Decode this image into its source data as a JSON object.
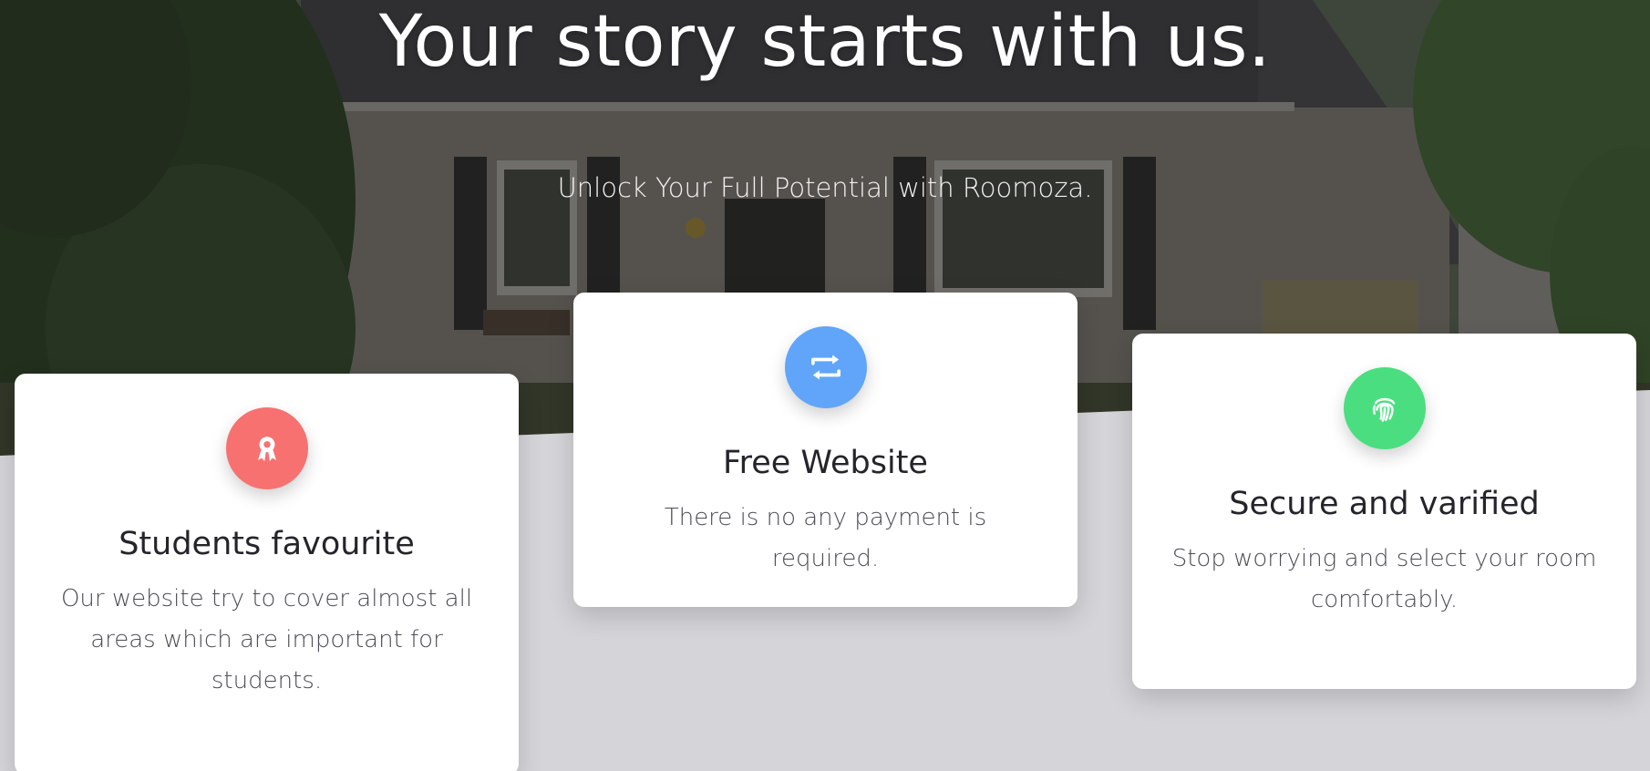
{
  "hero": {
    "title": "Your story starts with us.",
    "subtitle": "Unlock Your Full Potential with Roomoza."
  },
  "features": [
    {
      "icon": "award-ribbon-icon",
      "color": "#f87171",
      "title": "Students favourite",
      "text": "Our website try to cover almost all areas which are important for students."
    },
    {
      "icon": "retweet-arrows-icon",
      "color": "#60a5fa",
      "title": "Free Website",
      "text": "There is no any payment is required."
    },
    {
      "icon": "fingerprint-icon",
      "color": "#4ade80",
      "title": "Secure and varified",
      "text": "Stop worrying and select your room comfortably."
    }
  ]
}
